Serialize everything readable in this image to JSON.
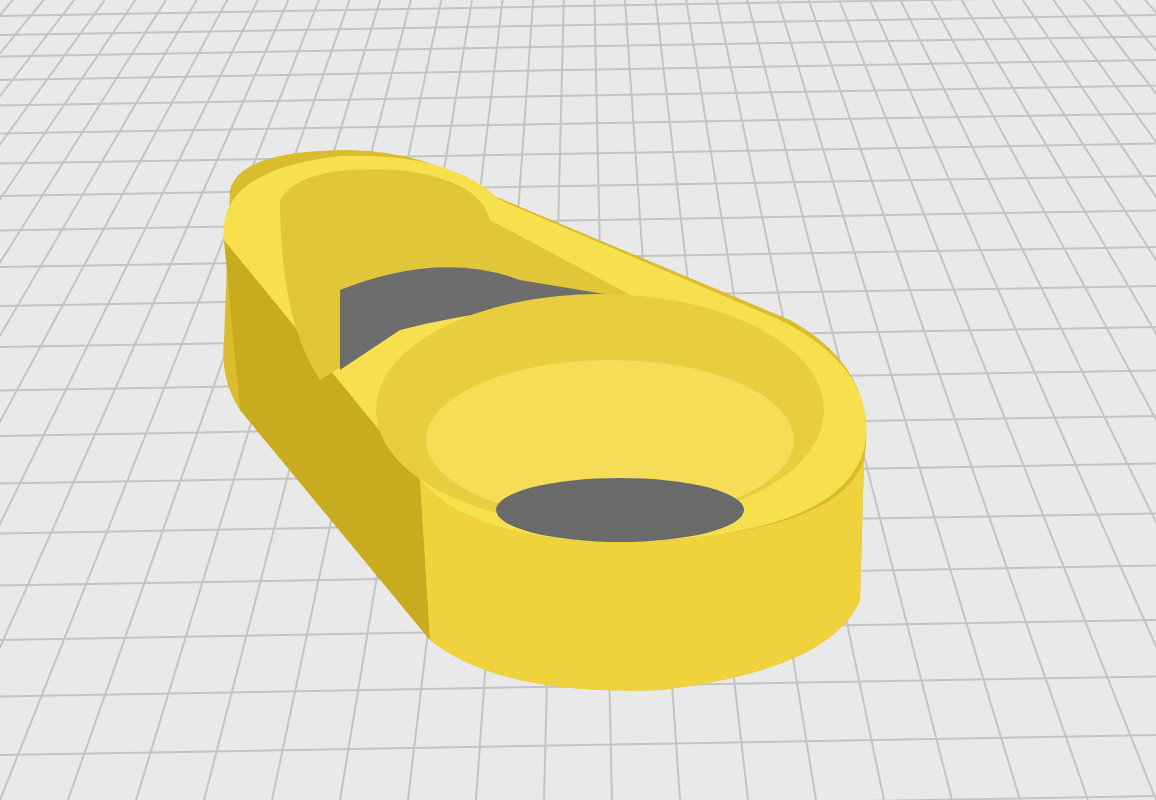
{
  "build_plate": {
    "grid": true
  }
}
